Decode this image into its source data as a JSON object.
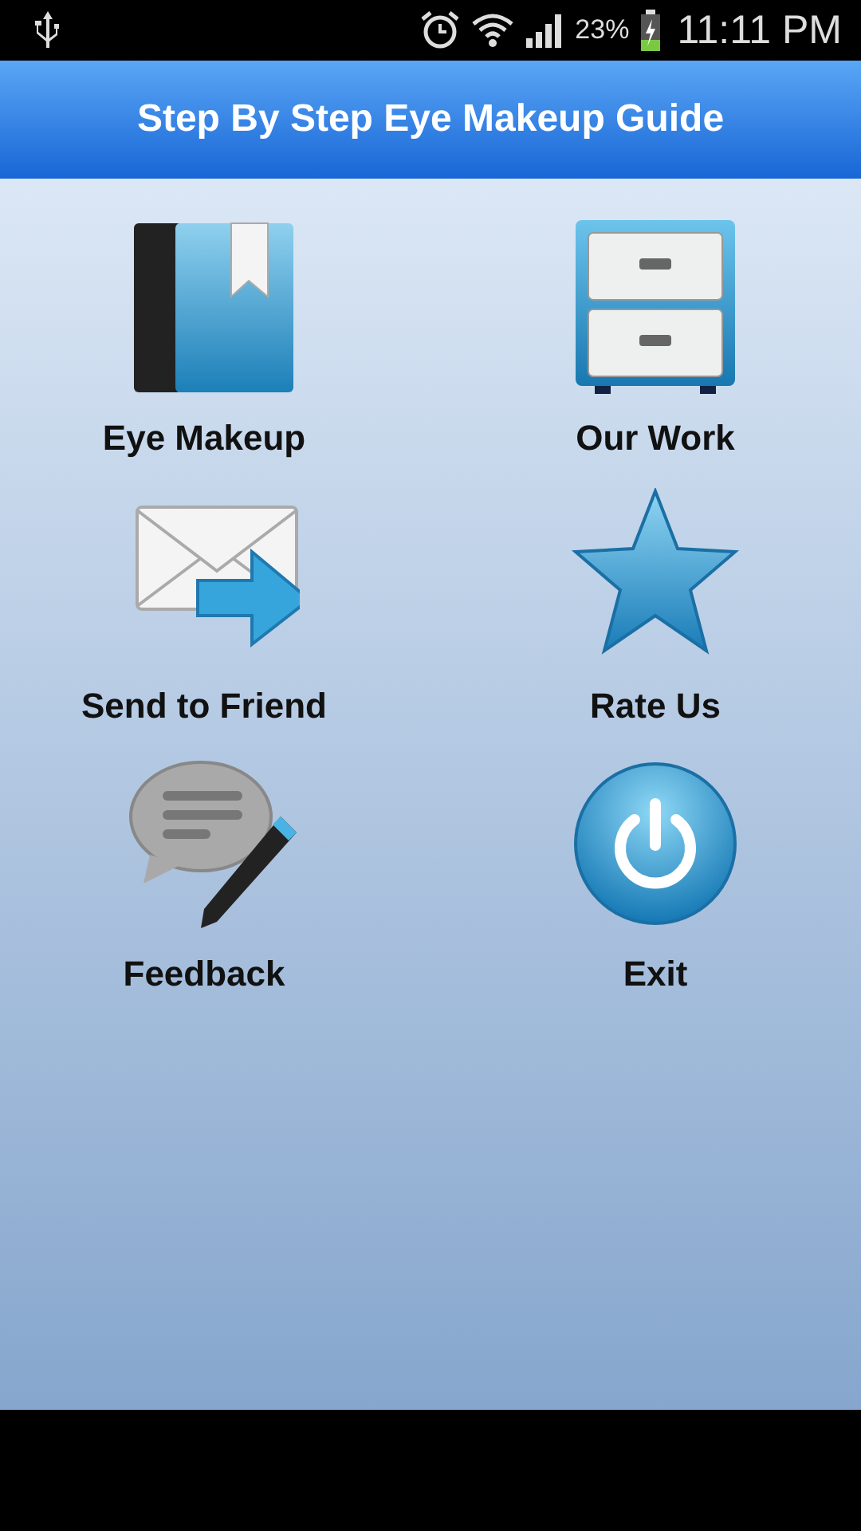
{
  "status_bar": {
    "battery": "23%",
    "time": "11:11 PM"
  },
  "title_bar": {
    "title": "Step By Step Eye Makeup Guide"
  },
  "menu": [
    {
      "label": "Eye Makeup",
      "kind": "book"
    },
    {
      "label": "Our Work",
      "kind": "cabinet"
    },
    {
      "label": "Send to Friend",
      "kind": "mail"
    },
    {
      "label": "Rate Us",
      "kind": "star"
    },
    {
      "label": "Feedback",
      "kind": "chat"
    },
    {
      "label": "Exit",
      "kind": "power"
    }
  ]
}
